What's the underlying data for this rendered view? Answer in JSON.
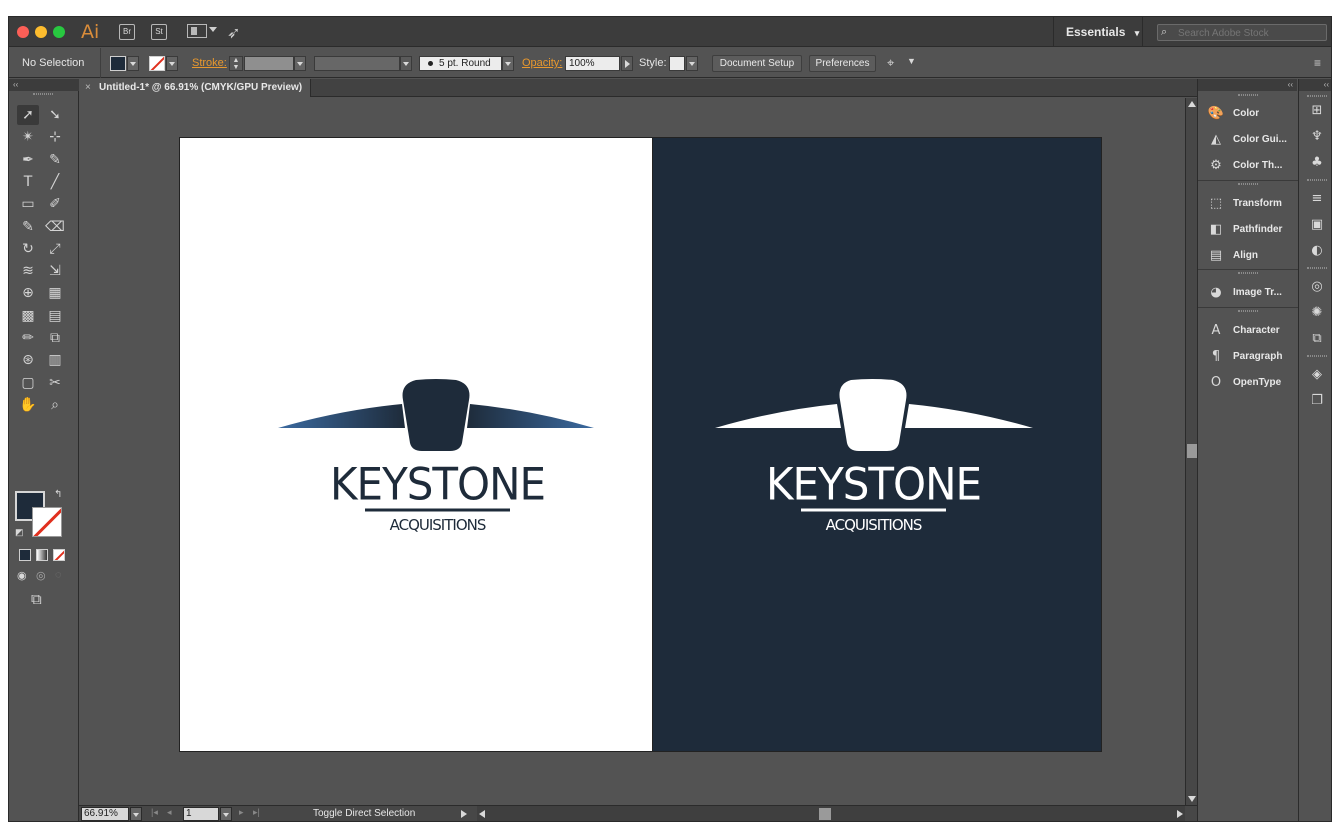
{
  "app": {
    "logo": "Ai",
    "bridge_label": "Br",
    "stock_label": "St",
    "workspace": "Essentials",
    "search_placeholder": "Search Adobe Stock"
  },
  "control": {
    "selection_status": "No Selection",
    "stroke_label": "Stroke:",
    "brush_value": "5 pt. Round",
    "opacity_label": "Opacity:",
    "opacity_value": "100%",
    "style_label": "Style:",
    "doc_setup_label": "Document Setup",
    "preferences_label": "Preferences"
  },
  "document": {
    "tab_title": "Untitled-1* @ 66.91% (CMYK/GPU Preview)"
  },
  "artwork": {
    "wordmark": "KEYSTONE",
    "subtitle": "ACQUISITIONS",
    "colors": {
      "navy": "#1e2b3a",
      "blue_gradient_end": "#3b6aa0",
      "white": "#ffffff"
    }
  },
  "status": {
    "zoom": "66.91%",
    "page": "1",
    "message": "Toggle Direct Selection"
  },
  "panels": [
    {
      "label": "Color",
      "icon": "palette-icon"
    },
    {
      "label": "Color Gui...",
      "icon": "color-guide-icon"
    },
    {
      "label": "Color Th...",
      "icon": "color-themes-icon"
    },
    {
      "label": "Transform",
      "icon": "transform-icon"
    },
    {
      "label": "Pathfinder",
      "icon": "pathfinder-icon"
    },
    {
      "label": "Align",
      "icon": "align-icon"
    },
    {
      "label": "Image Tr...",
      "icon": "image-trace-icon"
    },
    {
      "label": "Character",
      "icon": "character-icon"
    },
    {
      "label": "Paragraph",
      "icon": "paragraph-icon"
    },
    {
      "label": "OpenType",
      "icon": "opentype-icon"
    }
  ],
  "tools": [
    "selection-tool-icon",
    "direct-selection-tool-icon",
    "magic-wand-tool-icon",
    "lasso-tool-icon",
    "pen-tool-icon",
    "curvature-tool-icon",
    "type-tool-icon",
    "line-tool-icon",
    "rectangle-tool-icon",
    "paintbrush-tool-icon",
    "shaper-tool-icon",
    "eraser-tool-icon",
    "rotate-tool-icon",
    "scale-tool-icon",
    "warp-tool-icon",
    "free-transform-tool-icon",
    "shape-builder-tool-icon",
    "perspective-grid-tool-icon",
    "mesh-tool-icon",
    "gradient-tool-icon",
    "eyedropper-tool-icon",
    "blend-tool-icon",
    "symbol-sprayer-tool-icon",
    "column-graph-tool-icon",
    "artboard-tool-icon",
    "slice-tool-icon",
    "hand-tool-icon",
    "zoom-tool-icon"
  ]
}
